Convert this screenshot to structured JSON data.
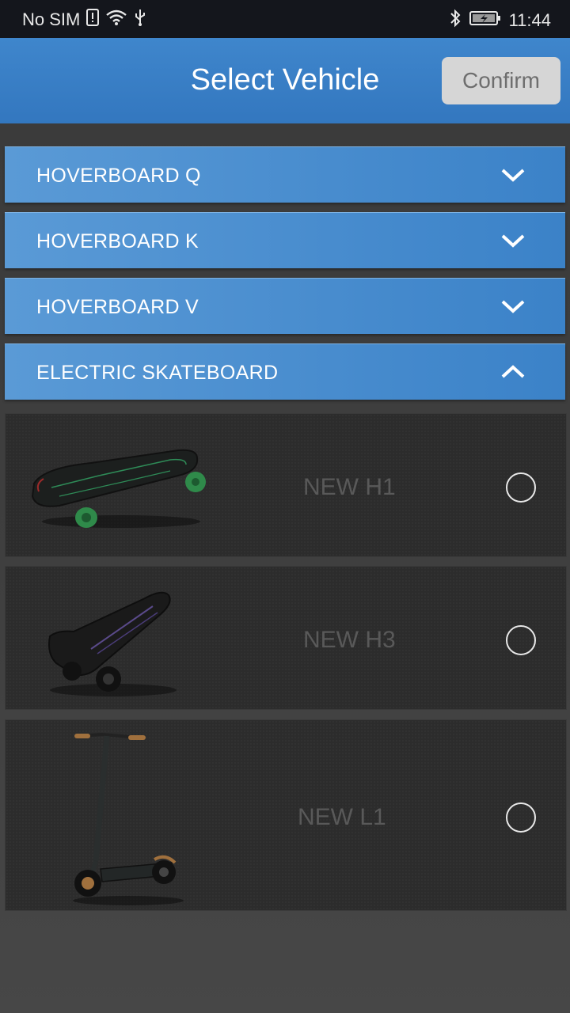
{
  "status_bar": {
    "carrier": "No SIM",
    "time": "11:44"
  },
  "header": {
    "title": "Select Vehicle",
    "confirm_label": "Confirm"
  },
  "categories": [
    {
      "label": "HOVERBOARD Q",
      "expanded": false
    },
    {
      "label": "HOVERBOARD K",
      "expanded": false
    },
    {
      "label": "HOVERBOARD V",
      "expanded": false
    },
    {
      "label": "ELECTRIC SKATEBOARD",
      "expanded": true
    }
  ],
  "vehicles": [
    {
      "name": "NEW H1",
      "image": "skateboard-image",
      "selected": false
    },
    {
      "name": "NEW H3",
      "image": "three-wheel-board-image",
      "selected": false
    },
    {
      "name": "NEW L1",
      "image": "kick-scooter-image",
      "selected": false
    }
  ],
  "colors": {
    "accent": "#3b82c8",
    "header": "#3a7fc6",
    "statusbar": "#14161c"
  }
}
